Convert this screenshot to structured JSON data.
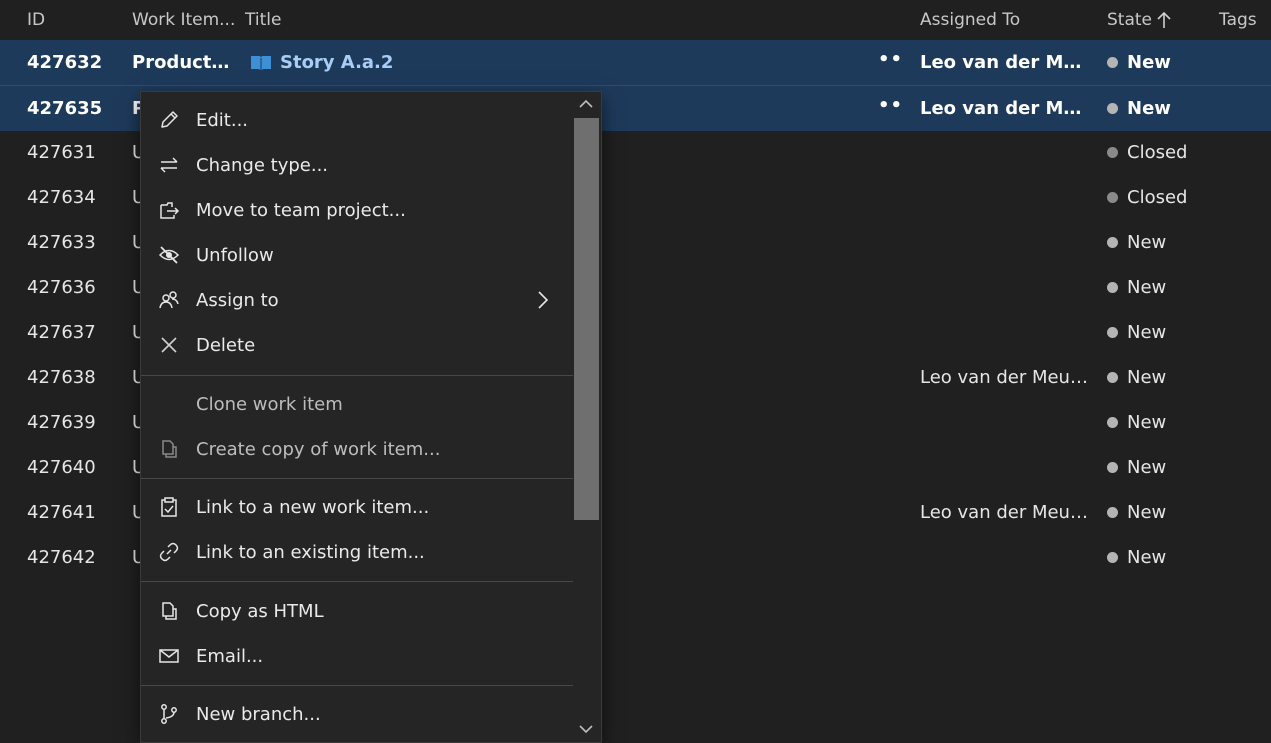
{
  "columns": {
    "id": "ID",
    "work_item_type": "Work Item...",
    "title": "Title",
    "assigned_to": "Assigned To",
    "state": "State",
    "tags": "Tags"
  },
  "rows": [
    {
      "id": "427632",
      "type": "Product ...",
      "title": "Story A.a.2",
      "more": "•••",
      "assigned": "Leo van der Meu...",
      "state": "New",
      "state_kind": "new",
      "selected": true
    },
    {
      "id": "427635",
      "type": "P",
      "title": "",
      "more": "•••",
      "assigned": "Leo van der Meu...",
      "state": "New",
      "state_kind": "new",
      "selected": true
    },
    {
      "id": "427631",
      "type": "U",
      "title": "",
      "assigned": "",
      "state": "Closed",
      "state_kind": "closed"
    },
    {
      "id": "427634",
      "type": "U",
      "title": "",
      "assigned": "",
      "state": "Closed",
      "state_kind": "closed"
    },
    {
      "id": "427633",
      "type": "U",
      "title": "",
      "assigned": "",
      "state": "New",
      "state_kind": "new"
    },
    {
      "id": "427636",
      "type": "U",
      "title": "",
      "assigned": "",
      "state": "New",
      "state_kind": "new"
    },
    {
      "id": "427637",
      "type": "U",
      "title": "",
      "assigned": "",
      "state": "New",
      "state_kind": "new"
    },
    {
      "id": "427638",
      "type": "U",
      "title": "",
      "assigned": "Leo van der Meulen",
      "state": "New",
      "state_kind": "new"
    },
    {
      "id": "427639",
      "type": "U",
      "title": "",
      "assigned": "",
      "state": "New",
      "state_kind": "new"
    },
    {
      "id": "427640",
      "type": "U",
      "title": "",
      "assigned": "",
      "state": "New",
      "state_kind": "new"
    },
    {
      "id": "427641",
      "type": "U",
      "title": "",
      "assigned": "Leo van der Meulen",
      "state": "New",
      "state_kind": "new"
    },
    {
      "id": "427642",
      "type": "U",
      "title": "",
      "assigned": "",
      "state": "New",
      "state_kind": "new"
    }
  ],
  "context_menu": {
    "items": [
      {
        "label": "Edit...",
        "icon": "pencil-icon"
      },
      {
        "label": "Change type...",
        "icon": "swap-arrows-icon"
      },
      {
        "label": "Move to team project...",
        "icon": "move-icon"
      },
      {
        "label": "Unfollow",
        "icon": "eye-slash-icon"
      },
      {
        "label": "Assign to",
        "icon": "people-icon"
      },
      {
        "label": "Delete",
        "icon": "close-icon"
      },
      {
        "label": "Clone work item",
        "icon": "",
        "disabled": true
      },
      {
        "label": "Create copy of work item...",
        "icon": "copy-icon",
        "disabled": true
      },
      {
        "label": "Link to a new work item...",
        "icon": "clipboard-check-icon"
      },
      {
        "label": "Link to an existing item...",
        "icon": "link-icon"
      },
      {
        "label": "Copy as HTML",
        "icon": "copy-icon"
      },
      {
        "label": "Email...",
        "icon": "mail-icon"
      },
      {
        "label": "New branch...",
        "icon": "branch-icon"
      }
    ]
  },
  "colors": {
    "background": "#202020",
    "selected_row": "#1e3a5b",
    "title_link": "#8cb8e8",
    "story_icon": "#3d8fd6",
    "menu_background": "#252525"
  }
}
